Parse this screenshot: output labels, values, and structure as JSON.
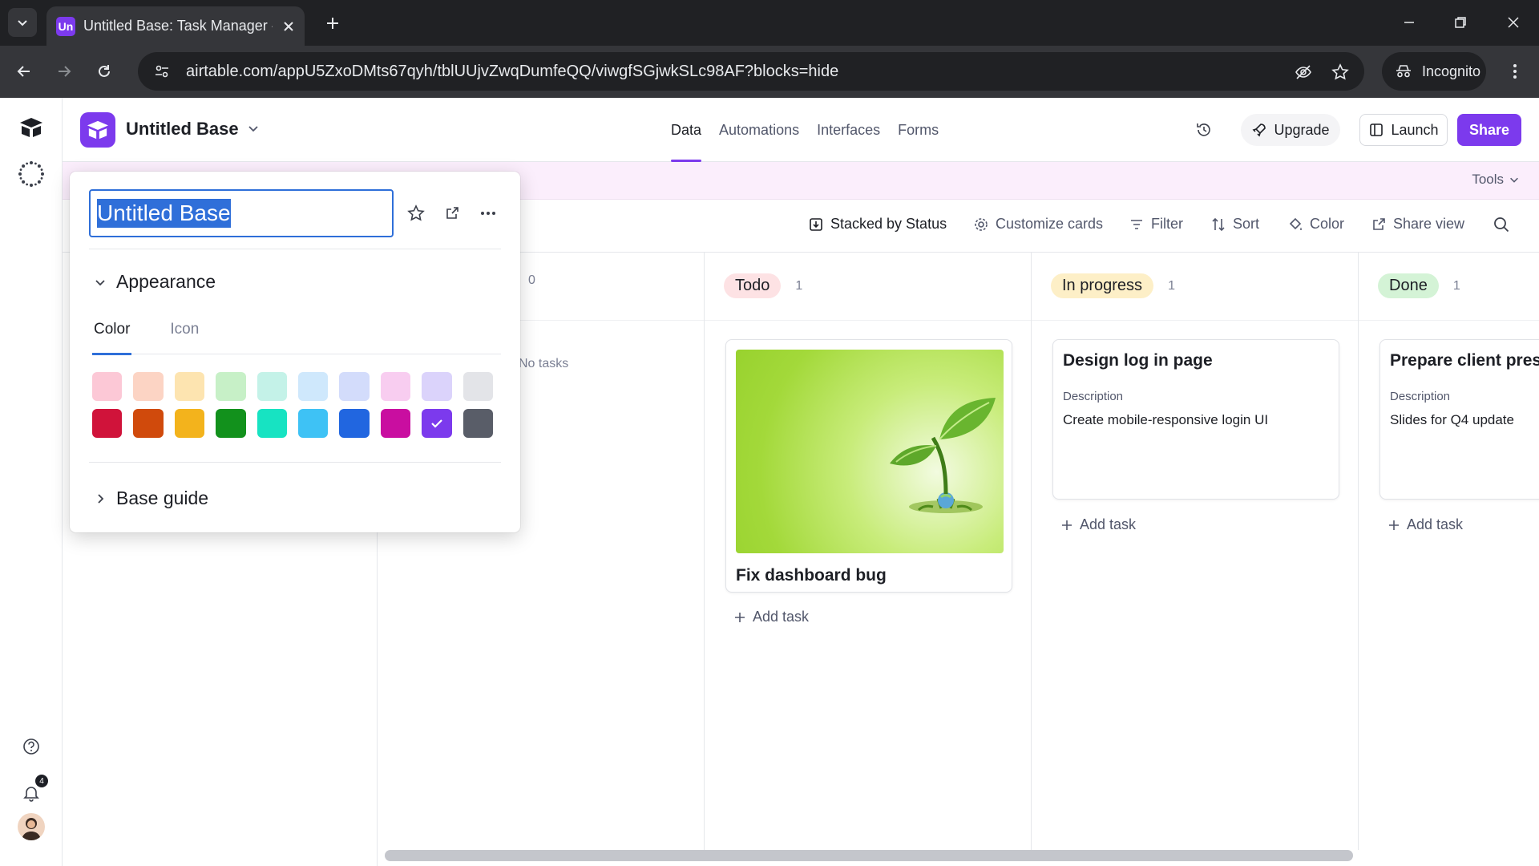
{
  "browser": {
    "tab_title": "Untitled Base: Task Manager - A",
    "favicon_text": "Un",
    "url": "airtable.com/appU5ZxoDMts67qyh/tblUUjvZwqDumfeQQ/viwgfSGjwkSLc98AF?blocks=hide",
    "incognito_label": "Incognito"
  },
  "rail": {
    "notification_count": "4"
  },
  "header": {
    "base_name": "Untitled Base",
    "nav_tabs": [
      {
        "label": "Data",
        "active": true
      },
      {
        "label": "Automations"
      },
      {
        "label": "Interfaces"
      },
      {
        "label": "Forms"
      }
    ],
    "upgrade_label": "Upgrade",
    "launch_label": "Launch",
    "share_label": "Share",
    "tools_label": "Tools",
    "accent_color": "#7c3aed"
  },
  "view_toolbar": {
    "stacked_by": "Stacked by Status",
    "customize": "Customize cards",
    "filter": "Filter",
    "sort": "Sort",
    "color": "Color",
    "share_view": "Share view"
  },
  "board": {
    "columns": [
      {
        "name": "",
        "count": "0",
        "empty_text": "No tasks"
      },
      {
        "name": "Todo",
        "count": "1",
        "pill_color": "#fde2e4",
        "card": {
          "title": "Fix dashboard bug"
        },
        "add_label": "Add task"
      },
      {
        "name": "In progress",
        "count": "1",
        "pill_color": "#fdefc7",
        "card": {
          "title": "Design log in page",
          "field_label": "Description",
          "field_value": "Create mobile-responsive login UI"
        },
        "add_label": "Add task"
      },
      {
        "name": "Done",
        "count": "1",
        "pill_color": "#d4f3d6",
        "card": {
          "title": "Prepare client pres",
          "field_label": "Description",
          "field_value": "Slides for Q4 update"
        },
        "add_label": "Add task"
      }
    ]
  },
  "popover": {
    "name_value": "Untitled Base",
    "appearance_label": "Appearance",
    "color_tab": "Color",
    "icon_tab": "Icon",
    "base_guide_label": "Base guide",
    "swatch_rows": [
      [
        "#fcc8d6",
        "#fcd4c4",
        "#fde4b0",
        "#c7f0c7",
        "#c4f2e8",
        "#cfe8fc",
        "#d3dcfb",
        "#f8cdf0",
        "#dbd3fb",
        "#e3e4e8"
      ],
      [
        "#d0133a",
        "#d04a0c",
        "#f3b31c",
        "#12911c",
        "#17e3c2",
        "#3ec2f5",
        "#2166e0",
        "#c90ea0",
        "#7c3aed",
        "#595d68"
      ]
    ],
    "selected_swatch": "#7c3aed"
  }
}
